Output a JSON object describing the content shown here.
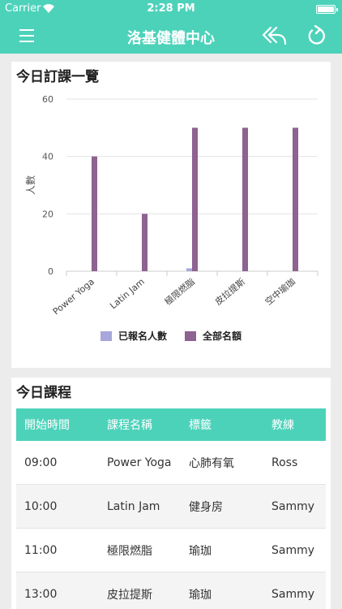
{
  "status": {
    "carrier": "Carrier",
    "time": "2:28 PM"
  },
  "nav": {
    "title": "洛基健體中心"
  },
  "booking_card": {
    "title": "今日訂課一覽"
  },
  "chart_data": {
    "type": "bar",
    "categories": [
      "Power Yoga",
      "Latin Jam",
      "極限燃脂",
      "皮拉提斯",
      "空中瑜珈"
    ],
    "series": [
      {
        "name": "已報名人數",
        "color": "#a7a7db",
        "values": [
          0,
          0,
          1,
          0,
          0
        ]
      },
      {
        "name": "全部名額",
        "color": "#8e6291",
        "values": [
          40,
          20,
          50,
          50,
          50
        ]
      }
    ],
    "ylabel": "人數",
    "ylim": [
      0,
      60
    ],
    "yticks": [
      0,
      20,
      40,
      60
    ],
    "grid": true,
    "legend": "bottom"
  },
  "courses_card": {
    "title": "今日課程",
    "headers": [
      "開始時間",
      "課程名稱",
      "標籤",
      "教練"
    ],
    "rows": [
      [
        "09:00",
        "Power Yoga",
        "心肺有氧",
        "Ross"
      ],
      [
        "10:00",
        "Latin Jam",
        "健身房",
        "Sammy"
      ],
      [
        "11:00",
        "極限燃脂",
        "瑜珈",
        "Sammy"
      ],
      [
        "13:00",
        "皮拉提斯",
        "瑜珈",
        "Sammy"
      ]
    ]
  }
}
